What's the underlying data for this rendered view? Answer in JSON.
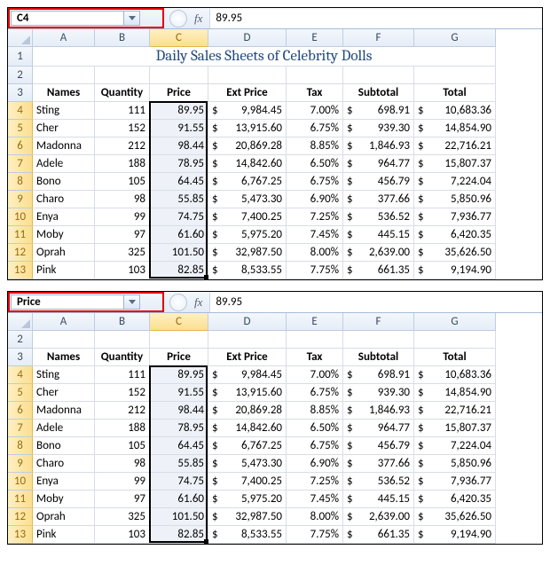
{
  "panels": [
    {
      "namebox": "C4",
      "formula": "89.95",
      "showTitle": true
    },
    {
      "namebox": "Price",
      "formula": "89.95",
      "showTitle": false
    }
  ],
  "fx_label": "fx",
  "title": "Daily Sales Sheets of Celebrity Dolls",
  "columns": [
    "A",
    "B",
    "C",
    "D",
    "E",
    "F",
    "G"
  ],
  "headers": {
    "A": "Names",
    "B": "Quantity",
    "C": "Price",
    "D": "Ext Price",
    "E": "Tax",
    "F": "Subtotal",
    "G": "Total"
  },
  "rows": [
    {
      "n": 4,
      "name": "Sting",
      "qty": "111",
      "price": "89.95",
      "ext": "9,984.45",
      "tax": "7.00%",
      "sub": "698.91",
      "tot": "10,683.36"
    },
    {
      "n": 5,
      "name": "Cher",
      "qty": "152",
      "price": "91.55",
      "ext": "13,915.60",
      "tax": "6.75%",
      "sub": "939.30",
      "tot": "14,854.90"
    },
    {
      "n": 6,
      "name": "Madonna",
      "qty": "212",
      "price": "98.44",
      "ext": "20,869.28",
      "tax": "8.85%",
      "sub": "1,846.93",
      "tot": "22,716.21"
    },
    {
      "n": 7,
      "name": "Adele",
      "qty": "188",
      "price": "78.95",
      "ext": "14,842.60",
      "tax": "6.50%",
      "sub": "964.77",
      "tot": "15,807.37"
    },
    {
      "n": 8,
      "name": "Bono",
      "qty": "105",
      "price": "64.45",
      "ext": "6,767.25",
      "tax": "6.75%",
      "sub": "456.79",
      "tot": "7,224.04"
    },
    {
      "n": 9,
      "name": "Charo",
      "qty": "98",
      "price": "55.85",
      "ext": "5,473.30",
      "tax": "6.90%",
      "sub": "377.66",
      "tot": "5,850.96"
    },
    {
      "n": 10,
      "name": "Enya",
      "qty": "99",
      "price": "74.75",
      "ext": "7,400.25",
      "tax": "7.25%",
      "sub": "536.52",
      "tot": "7,936.77"
    },
    {
      "n": 11,
      "name": "Moby",
      "qty": "97",
      "price": "61.60",
      "ext": "5,975.20",
      "tax": "7.45%",
      "sub": "445.15",
      "tot": "6,420.35"
    },
    {
      "n": 12,
      "name": "Oprah",
      "qty": "325",
      "price": "101.50",
      "ext": "32,987.50",
      "tax": "8.00%",
      "sub": "2,639.00",
      "tot": "35,626.50"
    },
    {
      "n": 13,
      "name": "Pink",
      "qty": "103",
      "price": "82.85",
      "ext": "8,533.55",
      "tax": "7.75%",
      "sub": "661.35",
      "tot": "9,194.90"
    }
  ],
  "currency": "$"
}
